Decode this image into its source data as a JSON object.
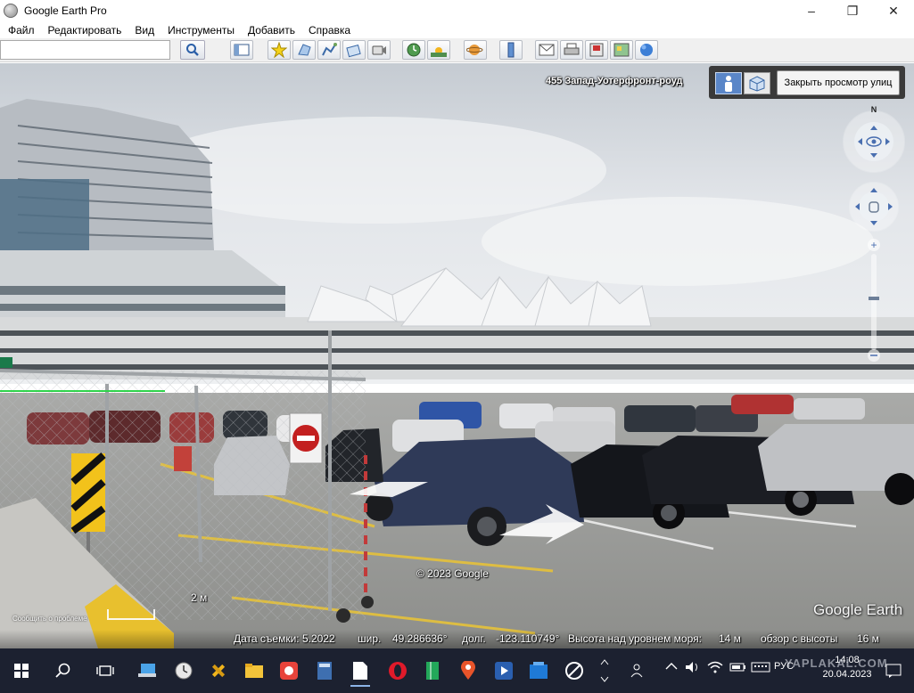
{
  "window": {
    "title": "Google Earth Pro",
    "minimize": "–",
    "maximize": "❐",
    "close": "✕"
  },
  "menu": {
    "items": [
      {
        "label": "Файл"
      },
      {
        "label": "Редактировать"
      },
      {
        "label": "Вид"
      },
      {
        "label": "Инструменты"
      },
      {
        "label": "Добавить"
      },
      {
        "label": "Справка"
      }
    ]
  },
  "toolbar": {
    "search_value": "",
    "tools": [
      "sidebar-icon",
      "placemark-icon",
      "polygon-icon",
      "path-icon",
      "overlay-icon",
      "record-tour-icon",
      "historical-imagery-icon",
      "sunlight-icon",
      "planets-icon",
      "ruler-icon",
      "email-icon",
      "print-icon",
      "save-image-icon",
      "maps-icon",
      "earth-icon"
    ]
  },
  "viewer": {
    "address": "455 Запад-Уотерфронт-роуд",
    "close_street_view": "Закрыть просмотр улиц",
    "compass_north": "N",
    "copyright": "© 2023 Google",
    "logo": "Google Earth",
    "scale_label": "2 м",
    "report_problem": "Сообщить о проблеме",
    "sign_text": "Ⓒ"
  },
  "status": {
    "capture_date": "Дата съемки: 5.2022",
    "lat_label": "шир.",
    "lat_value": "49.286636°",
    "lon_label": "долг.",
    "lon_value": "-123.110749°",
    "elev_label": "Высота над уровнем моря:",
    "elev_value": "14 м",
    "eye_label": "обзор с высоты",
    "eye_value": "16 м"
  },
  "taskbar": {
    "language": "РУС",
    "time": "14:08",
    "date": "20.04.2023",
    "watermark": "YAPLAKAL.COM"
  },
  "colors": {
    "taskbar_bg": "#1c2130",
    "sv_active": "#5a86c8",
    "sky": "#d5dadf"
  }
}
